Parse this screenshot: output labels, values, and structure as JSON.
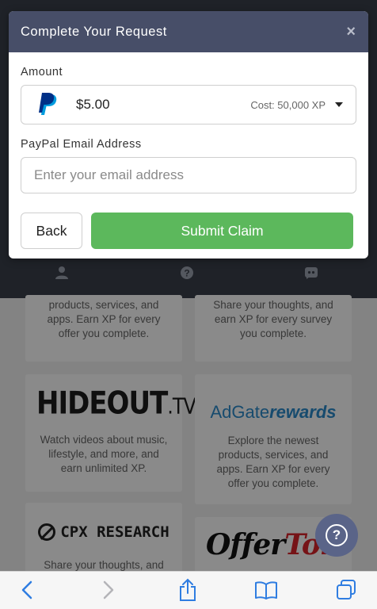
{
  "modal": {
    "title": "Complete Your Request",
    "close_glyph": "×",
    "amount_label": "Amount",
    "amount_value": "$5.00",
    "amount_cost": "Cost: 50,000 XP",
    "email_label": "PayPal Email Address",
    "email_placeholder": "Enter your email address",
    "email_value": "",
    "back_label": "Back",
    "submit_label": "Submit Claim",
    "colors": {
      "header": "#474e68",
      "submit": "#5cb85c"
    }
  },
  "nav_icons": [
    "user-icon",
    "help-circle-icon",
    "discord-icon"
  ],
  "cards": [
    {
      "desc": "products, services, and apps. Earn XP for every offer you complete."
    },
    {
      "desc": "Share your thoughts, and earn XP for every survey you complete."
    },
    {
      "logo_main": "HIDEOUT",
      "logo_suffix": ".TV",
      "desc": "Watch videos about music, lifestyle, and more, and earn unlimited XP."
    },
    {
      "logo_main": "AdGate",
      "logo_suffix": "rewards",
      "desc": "Explore the newest products, services, and apps. Earn XP for every offer you complete."
    },
    {
      "logo_main": "CPX RESEARCH",
      "desc": "Share your thoughts, and"
    },
    {
      "logo_main": "Offer",
      "logo_suffix": "Toro"
    }
  ],
  "help_fab": {
    "glyph": "?"
  },
  "toolbar_icons": [
    "back-arrow-icon",
    "forward-arrow-icon",
    "share-icon",
    "bookmarks-icon",
    "tabs-icon"
  ]
}
